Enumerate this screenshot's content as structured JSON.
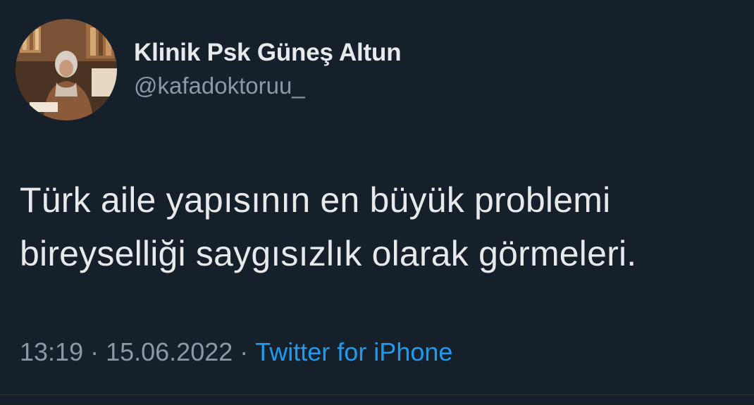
{
  "tweet": {
    "display_name": "Klinik Psk Güneş Altun",
    "handle": "@kafadoktoruu_",
    "text_lines": [
      "Türk aile yapısının en büyük problemi",
      "bireyselliği saygısızlık olarak görmeleri."
    ],
    "time": "13:19",
    "separator": "·",
    "date": "15.06.2022",
    "source": "Twitter for iPhone"
  },
  "colors": {
    "background": "#15202b",
    "primary_text": "#e7e9ea",
    "secondary_text": "#8b98a5",
    "link": "#1d9bf0"
  },
  "icons": {
    "avatar": "profile-photo"
  }
}
